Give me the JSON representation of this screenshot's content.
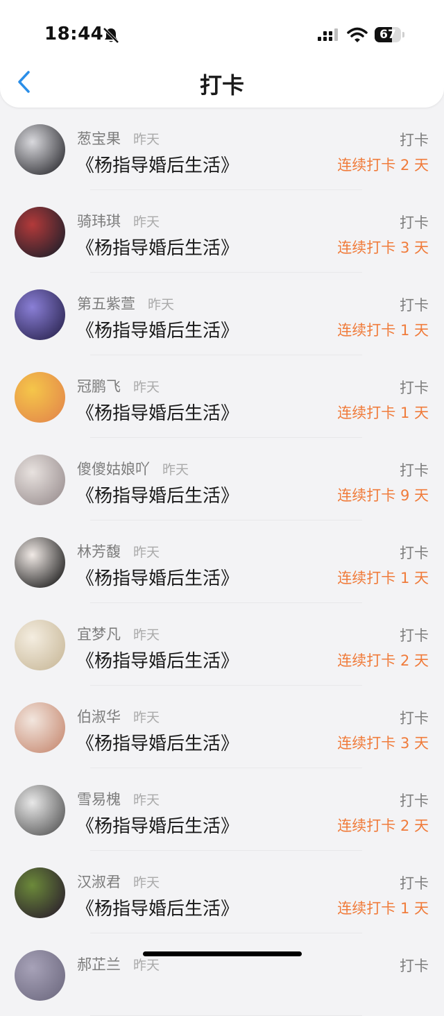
{
  "status_bar": {
    "time": "18:44",
    "battery": "67"
  },
  "nav": {
    "title": "打卡"
  },
  "colors": {
    "accent": "#f07b3a",
    "back": "#2a8ee8"
  },
  "rows": [
    {
      "name": "葱宝果",
      "time": "昨天",
      "book": "《杨指导婚后生活》",
      "action": "打卡",
      "streak": "连续打卡 2 天",
      "avatar_colors": [
        "#d9d9dd",
        "#2c2c31"
      ]
    },
    {
      "name": "骑玮琪",
      "time": "昨天",
      "book": "《杨指导婚后生活》",
      "action": "打卡",
      "streak": "连续打卡 3 天",
      "avatar_colors": [
        "#b33a3a",
        "#1d1f2a"
      ]
    },
    {
      "name": "第五紫萱",
      "time": "昨天",
      "book": "《杨指导婚后生活》",
      "action": "打卡",
      "streak": "连续打卡 1 天",
      "avatar_colors": [
        "#8a7fd6",
        "#2a2450"
      ]
    },
    {
      "name": "冠鹏飞",
      "time": "昨天",
      "book": "《杨指导婚后生活》",
      "action": "打卡",
      "streak": "连续打卡 1 天",
      "avatar_colors": [
        "#f5c64a",
        "#e3874a"
      ]
    },
    {
      "name": "傻傻姑娘吖",
      "time": "昨天",
      "book": "《杨指导婚后生活》",
      "action": "打卡",
      "streak": "连续打卡 9 天",
      "avatar_colors": [
        "#e8e2df",
        "#9a8f90"
      ]
    },
    {
      "name": "林芳馥",
      "time": "昨天",
      "book": "《杨指导婚后生活》",
      "action": "打卡",
      "streak": "连续打卡 1 天",
      "avatar_colors": [
        "#f1eae6",
        "#1a1a1a"
      ]
    },
    {
      "name": "宜梦凡",
      "time": "昨天",
      "book": "《杨指导婚后生活》",
      "action": "打卡",
      "streak": "连续打卡 2 天",
      "avatar_colors": [
        "#f4ede0",
        "#c9b99a"
      ]
    },
    {
      "name": "伯淑华",
      "time": "昨天",
      "book": "《杨指导婚后生活》",
      "action": "打卡",
      "streak": "连续打卡 3 天",
      "avatar_colors": [
        "#f2e6de",
        "#c78a72"
      ]
    },
    {
      "name": "雪易槐",
      "time": "昨天",
      "book": "《杨指导婚后生活》",
      "action": "打卡",
      "streak": "连续打卡 2 天",
      "avatar_colors": [
        "#e8e8e8",
        "#555555"
      ]
    },
    {
      "name": "汉淑君",
      "time": "昨天",
      "book": "《杨指导婚后生活》",
      "action": "打卡",
      "streak": "连续打卡 1 天",
      "avatar_colors": [
        "#6c8a3a",
        "#2a1e2c"
      ]
    },
    {
      "name": "郝芷兰",
      "time": "昨天",
      "book": "",
      "action": "打卡",
      "streak": "",
      "avatar_colors": [
        "#a7a2b8",
        "#6e6a80"
      ]
    }
  ]
}
